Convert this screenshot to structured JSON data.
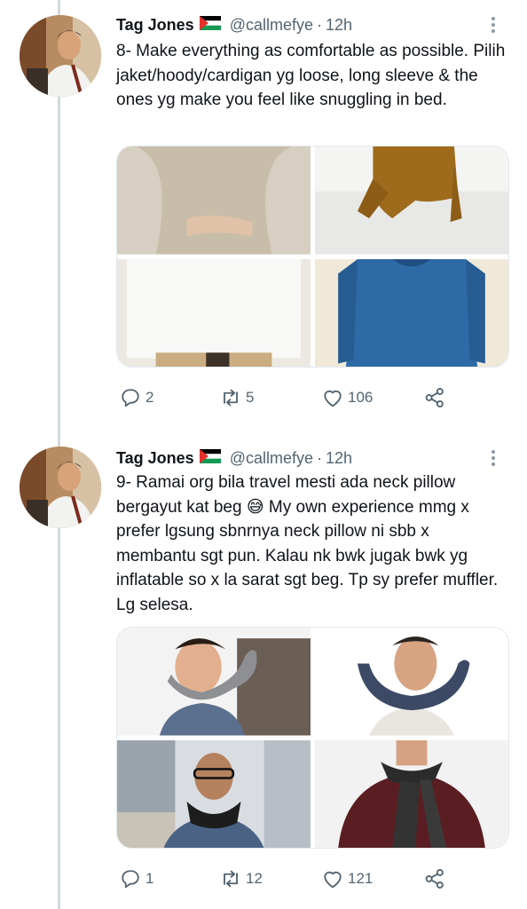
{
  "tweets": [
    {
      "author": {
        "name": "Tag Jones",
        "handle": "@callmefye",
        "time": "12h"
      },
      "separator": "·",
      "text": "8- Make everything as comfortable as possible. Pilih jaket/hoody/cardigan yg loose, long sleeve & the ones yg make you feel like snuggling in bed.",
      "media": [
        "beige knit sweater",
        "mustard chunky sweater",
        "white long sleeve shirt",
        "blue long sleeve top"
      ],
      "stats": {
        "replies": "2",
        "retweets": "5",
        "likes": "106"
      }
    },
    {
      "author": {
        "name": "Tag Jones",
        "handle": "@callmefye",
        "time": "12h"
      },
      "separator": "·",
      "text": "9- Ramai org bila travel mesti ada neck pillow bergayut kat beg 😅 My own experience mmg x prefer lgsung sbnrnya neck pillow ni sbb x membantu sgt pun. Kalau nk bwk jugak bwk yg inflatable so x la sarat sgt beg. Tp sy prefer muffler. Lg selesa.",
      "media": [
        "grey neck pillow",
        "navy neck pillow",
        "man with black scarf",
        "dark knit scarf"
      ],
      "stats": {
        "replies": "1",
        "retweets": "12",
        "likes": "121"
      }
    }
  ],
  "icons": {
    "reply": "reply-icon",
    "retweet": "retweet-icon",
    "like": "heart-icon",
    "share": "share-icon",
    "more": "more-options-icon",
    "flag": "palestine-flag-icon"
  },
  "colors": {
    "text": "#0f1419",
    "secondary": "#536471",
    "thread_line": "#cfd9de"
  }
}
